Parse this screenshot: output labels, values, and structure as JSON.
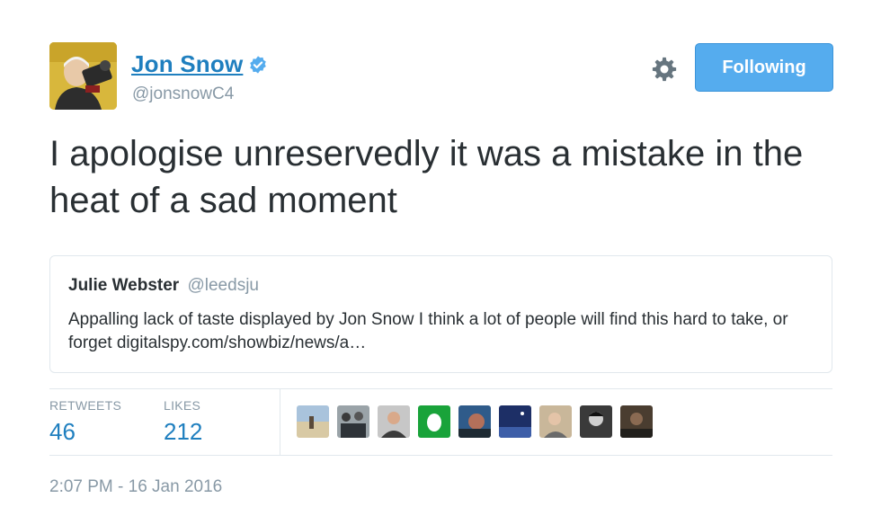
{
  "author": {
    "name": "Jon Snow",
    "handle": "@jonsnowC4",
    "avatar_icon": "user-avatar-photo",
    "verified_icon": "verified-badge-icon",
    "name_color": "#1f7fbf"
  },
  "actions": {
    "settings_icon": "gear-icon",
    "follow_label": "Following",
    "follow_color": "#55acee"
  },
  "tweet": {
    "text": "I apologise unreservedly it was a mistake in the heat of a sad moment"
  },
  "quoted": {
    "name": "Julie Webster",
    "handle": "@leedsju",
    "text": "Appalling lack of taste displayed by Jon Snow I think a lot of people will find this hard to take, or forget  digitalspy.com/showbiz/news/a…"
  },
  "stats": [
    {
      "label": "RETWEETS",
      "value": "46"
    },
    {
      "label": "LIKES",
      "value": "212"
    }
  ],
  "likers": [
    {
      "icon": "beach-photo-avatar"
    },
    {
      "icon": "group-photo-avatar"
    },
    {
      "icon": "man-photo-avatar"
    },
    {
      "icon": "egg-default-avatar"
    },
    {
      "icon": "portrait-photo-avatar"
    },
    {
      "icon": "night-sky-avatar"
    },
    {
      "icon": "older-man-avatar"
    },
    {
      "icon": "bw-portrait-avatar"
    },
    {
      "icon": "dark-portrait-avatar"
    }
  ],
  "timestamp": "2:07 PM - 16 Jan 2016"
}
